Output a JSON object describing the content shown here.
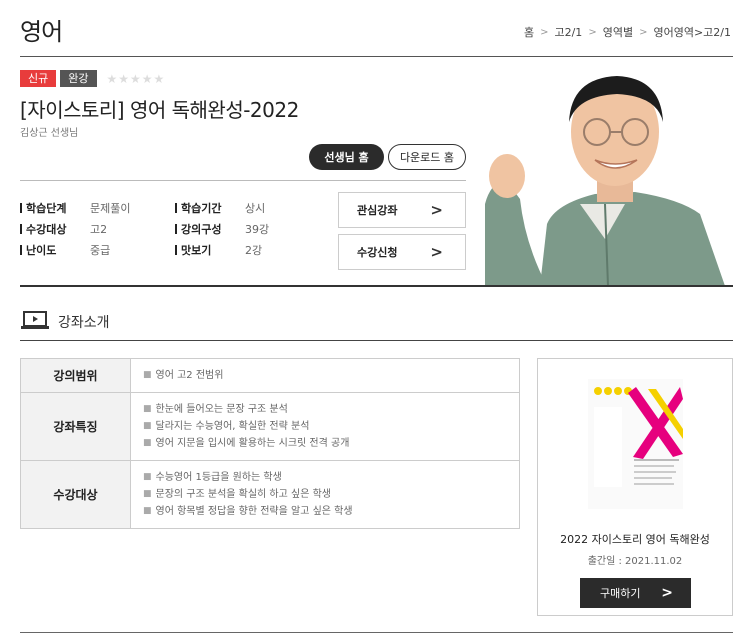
{
  "header": {
    "title": "영어",
    "breadcrumb": [
      "홈",
      "고2/1",
      "영역별",
      "영어영역>고2/1"
    ]
  },
  "course": {
    "badges": {
      "new": "신규",
      "done": "완강"
    },
    "rating": 0,
    "title": "[자이스토리] 영어 독해완성-2022",
    "teacher": "김상근 선생님",
    "teacher_home_label": "선생님 홈",
    "download_home_label": "다운로드 홈",
    "info": {
      "stage_label": "학습단계",
      "stage": "문제풀이",
      "period_label": "학습기간",
      "period": "상시",
      "target_label": "수강대상",
      "target": "고2",
      "lectures_label": "강의구성",
      "lectures": "39강",
      "level_label": "난이도",
      "level": "중급",
      "preview_label": "맛보기",
      "preview": "2강"
    },
    "wish_label": "관심강좌",
    "enroll_label": "수강신청"
  },
  "intro": {
    "section_title": "강좌소개",
    "rows": [
      {
        "head": "강의범위",
        "items": [
          "영어 고2 전범위"
        ]
      },
      {
        "head": "강좌특징",
        "items": [
          "한눈에 들어오는 문장 구조 분석",
          "달라지는 수능영어, 확실한 전략 분석",
          "영어 지문을 입시에 활용하는 시크릿 전격 공개"
        ]
      },
      {
        "head": "수강대상",
        "items": [
          "수능영어 1등급을 원하는 학생",
          "문장의 구조 분석을 확실히 하고 싶은 학생",
          "영어 항목별 정답을 향한 전략을 알고 싶은 학생"
        ]
      }
    ]
  },
  "book": {
    "title": "2022 자이스토리 영어 독해완성",
    "date": "출간일 : 2021.11.02",
    "buy_label": "구매하기"
  },
  "colors": {
    "accent": "#e83c3c",
    "dark": "#2b2b2b",
    "book_pink": "#e6007e",
    "book_yellow": "#f5d000"
  }
}
